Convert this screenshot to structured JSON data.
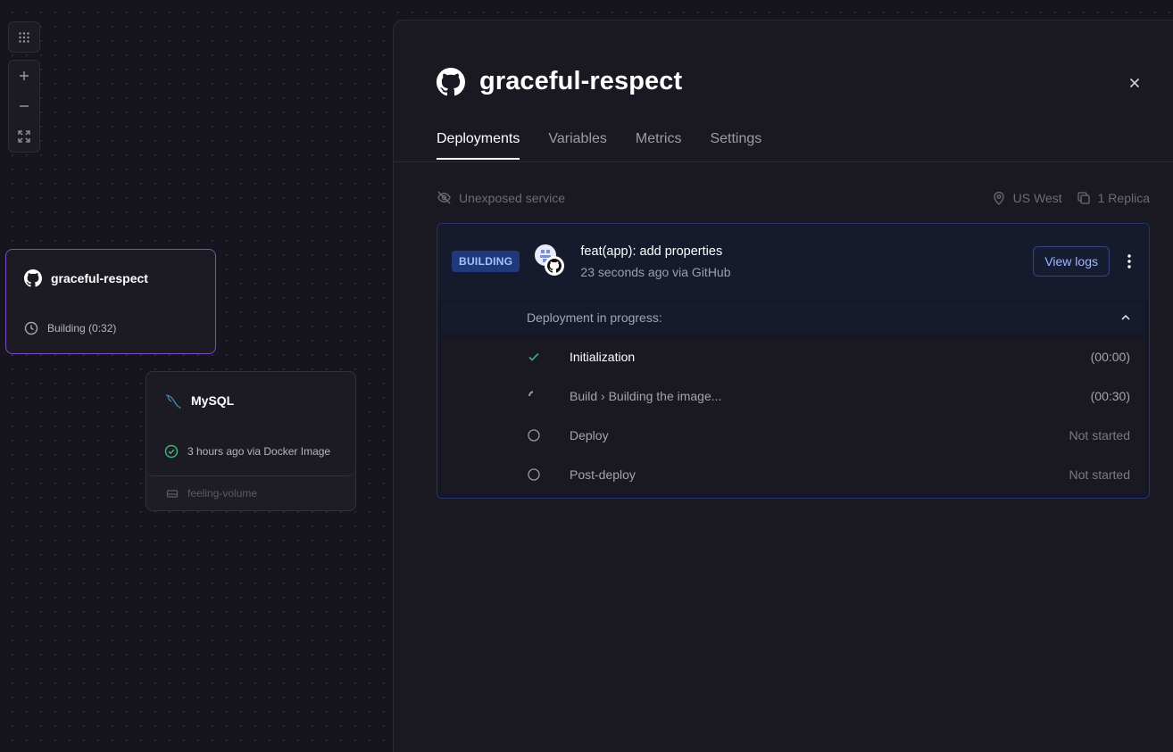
{
  "canvas": {
    "controls": [
      "grid-menu",
      "zoom-in",
      "zoom-out",
      "fit-view"
    ]
  },
  "cards": {
    "service": {
      "name": "graceful-respect",
      "status": "Building (0:32)"
    },
    "mysql": {
      "name": "MySQL",
      "status": "3 hours ago via Docker Image",
      "volume": "feeling-volume"
    }
  },
  "panel": {
    "title": "graceful-respect",
    "tabs": [
      {
        "label": "Deployments",
        "active": true
      },
      {
        "label": "Variables",
        "active": false
      },
      {
        "label": "Metrics",
        "active": false
      },
      {
        "label": "Settings",
        "active": false
      }
    ],
    "exposure": "Unexposed service",
    "region": "US West",
    "replicas": "1 Replica",
    "deployment": {
      "badge": "BUILDING",
      "commit_message": "feat(app): add properties",
      "commit_meta": "23 seconds ago via GitHub",
      "view_logs_label": "View logs",
      "progress_label": "Deployment in progress:",
      "steps": [
        {
          "label": "Initialization",
          "time": "(00:00)",
          "state": "done"
        },
        {
          "label": "Build › Building the image...",
          "time": "(00:30)",
          "state": "running"
        },
        {
          "label": "Deploy",
          "time": "Not started",
          "state": "pending"
        },
        {
          "label": "Post-deploy",
          "time": "Not started",
          "state": "pending"
        }
      ]
    }
  },
  "colors": {
    "accent_purple": "#7c4dbe",
    "badge_bg": "#1f3a7a",
    "success_green": "#3fb27f",
    "link_blue": "#9fb6ff"
  }
}
